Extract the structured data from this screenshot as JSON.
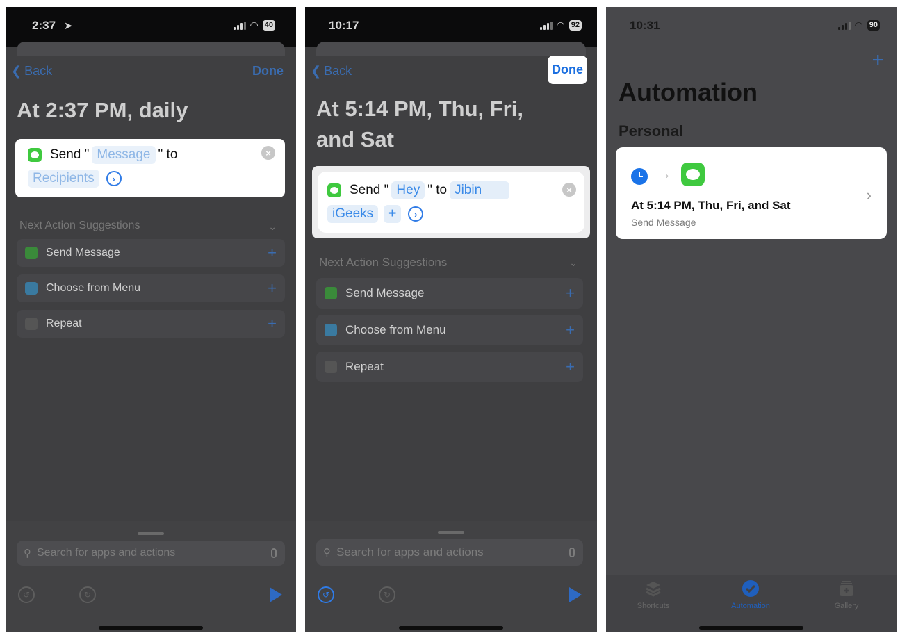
{
  "panel1": {
    "time": "2:37",
    "battery": "40",
    "back": "Back",
    "done": "Done",
    "title": "At 2:37 PM, daily",
    "action": {
      "send": "Send \"",
      "message": "Message",
      "to": "\" to",
      "recipients": "Recipients"
    },
    "suggestions_header": "Next Action Suggestions",
    "suggestions": [
      "Send Message",
      "Choose from Menu",
      "Repeat"
    ],
    "search_placeholder": "Search for apps and actions"
  },
  "panel2": {
    "time": "10:17",
    "battery": "92",
    "back": "Back",
    "done": "Done",
    "title_line1": "At 5:14 PM, Thu, Fri,",
    "title_line2": "and Sat",
    "action": {
      "send": "Send \"",
      "message": "Hey",
      "to": "\" to",
      "recipient_first": "Jibin",
      "recipient_second": "iGeeks"
    },
    "suggestions_header": "Next Action Suggestions",
    "suggestions": [
      "Send Message",
      "Choose from Menu",
      "Repeat"
    ],
    "search_placeholder": "Search for apps and actions"
  },
  "panel3": {
    "time": "10:31",
    "battery": "90",
    "title": "Automation",
    "section": "Personal",
    "automation": {
      "title": "At 5:14 PM, Thu, Fri, and Sat",
      "subtitle": "Send Message"
    },
    "tabs": [
      "Shortcuts",
      "Automation",
      "Gallery"
    ]
  },
  "colors": {
    "accent": "#1b6fe0",
    "dim_overlay": "#3f3f41",
    "messages_green": "#3fc93f"
  }
}
